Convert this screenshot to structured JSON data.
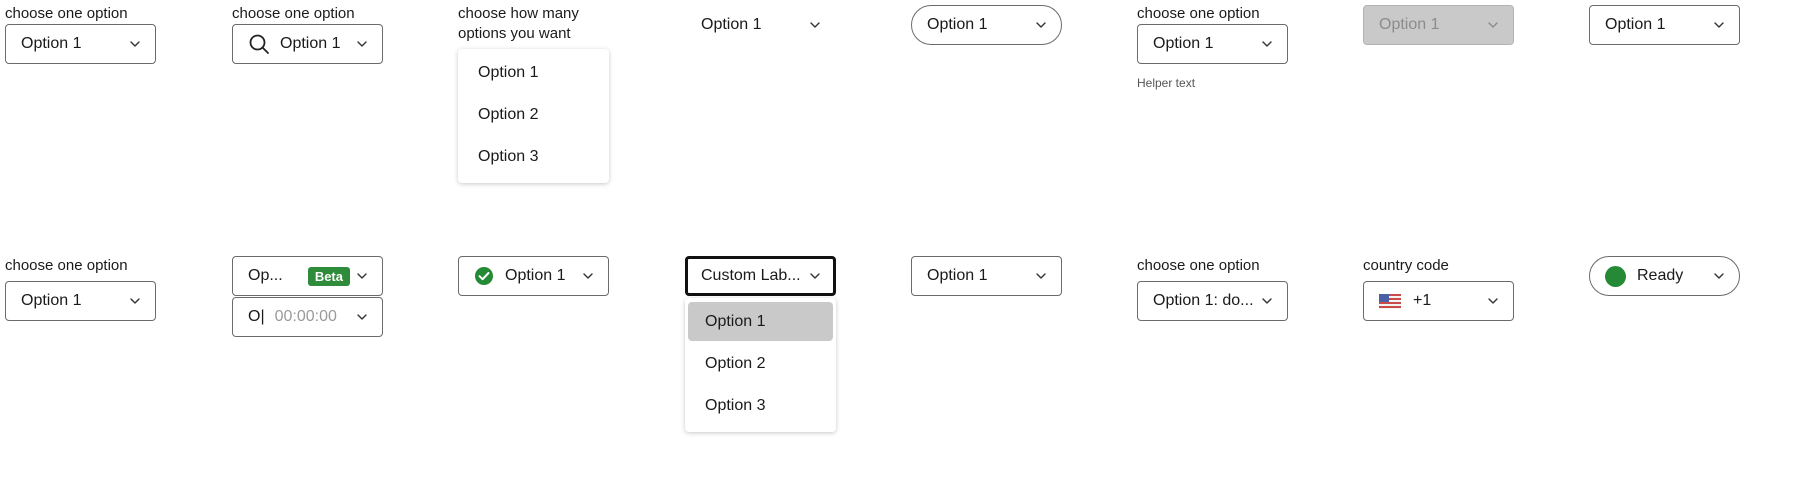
{
  "row1": {
    "c1": {
      "label": "choose one option",
      "value": "Option 1"
    },
    "c2": {
      "label": "choose one option",
      "value": "Option 1",
      "icon": "search-icon"
    },
    "c3": {
      "label": "choose how many options you want",
      "options": [
        "Option 1",
        "Option 2",
        "Option 3"
      ]
    },
    "c4": {
      "value": "Option 1"
    },
    "c5": {
      "value": "Option 1"
    },
    "c6": {
      "label": "choose one option",
      "value": "Option 1",
      "helper": "Helper text"
    },
    "c7": {
      "value": "Option 1",
      "state": "disabled"
    },
    "c8": {
      "value": "Option 1"
    }
  },
  "row2": {
    "c1": {
      "label": "choose one option",
      "value": "Option 1"
    },
    "c2": {
      "value": "Op...",
      "badge": "Beta",
      "value2": "O|",
      "time_placeholder": "00:00:00"
    },
    "c3": {
      "value": "Option 1",
      "icon": "check-circle-icon"
    },
    "c4": {
      "value": "Custom Lab...",
      "options": [
        "Option 1",
        "Option 2",
        "Option 3"
      ],
      "highlighted": "Option 1"
    },
    "c5": {
      "value": "Option 1"
    },
    "c6": {
      "label": "choose one option",
      "value": "Option 1: do..."
    },
    "c7": {
      "label": "country code",
      "value": "+1",
      "icon": "us-flag-icon"
    },
    "c8": {
      "value": "Ready",
      "status_color": "#258a35"
    }
  },
  "colors": {
    "badge": "#2e8b3a",
    "disabled_bg": "#c9c9c9",
    "status_ready": "#258a35"
  }
}
